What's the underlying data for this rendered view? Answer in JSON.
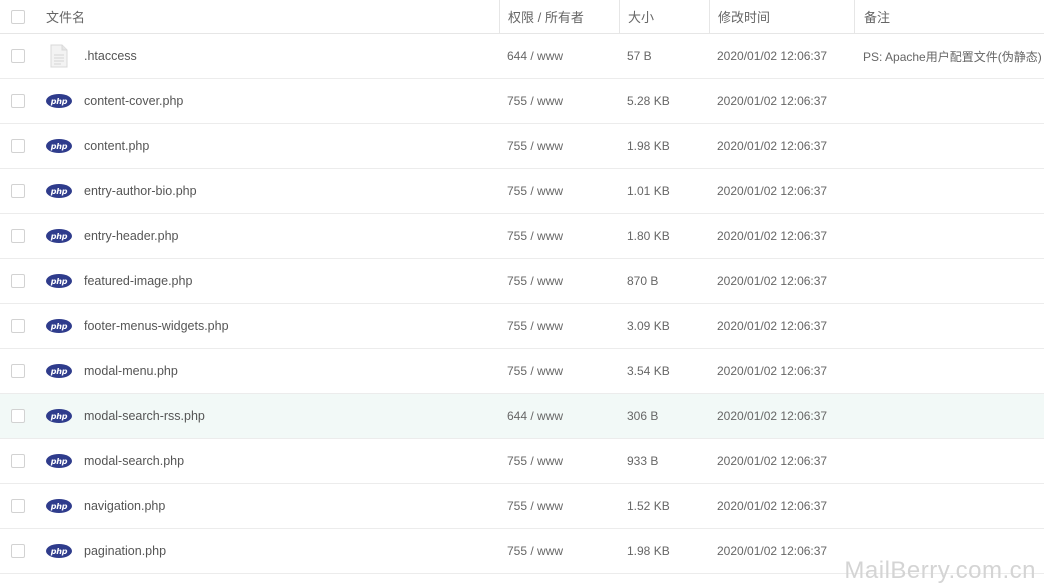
{
  "header": {
    "name": "文件名",
    "permission": "权限 / 所有者",
    "size": "大小",
    "modified": "修改时间",
    "note": "备注"
  },
  "rows": [
    {
      "icon": "file-icon",
      "name": ".htaccess",
      "perm": "644 / www",
      "size": "57 B",
      "time": "2020/01/02 12:06:37",
      "note": "PS: Apache用户配置文件(伪静态)"
    },
    {
      "icon": "php-icon",
      "name": "content-cover.php",
      "perm": "755 / www",
      "size": "5.28 KB",
      "time": "2020/01/02 12:06:37",
      "note": ""
    },
    {
      "icon": "php-icon",
      "name": "content.php",
      "perm": "755 / www",
      "size": "1.98 KB",
      "time": "2020/01/02 12:06:37",
      "note": ""
    },
    {
      "icon": "php-icon",
      "name": "entry-author-bio.php",
      "perm": "755 / www",
      "size": "1.01 KB",
      "time": "2020/01/02 12:06:37",
      "note": ""
    },
    {
      "icon": "php-icon",
      "name": "entry-header.php",
      "perm": "755 / www",
      "size": "1.80 KB",
      "time": "2020/01/02 12:06:37",
      "note": ""
    },
    {
      "icon": "php-icon",
      "name": "featured-image.php",
      "perm": "755 / www",
      "size": "870 B",
      "time": "2020/01/02 12:06:37",
      "note": ""
    },
    {
      "icon": "php-icon",
      "name": "footer-menus-widgets.php",
      "perm": "755 / www",
      "size": "3.09 KB",
      "time": "2020/01/02 12:06:37",
      "note": ""
    },
    {
      "icon": "php-icon",
      "name": "modal-menu.php",
      "perm": "755 / www",
      "size": "3.54 KB",
      "time": "2020/01/02 12:06:37",
      "note": ""
    },
    {
      "icon": "php-icon",
      "name": "modal-search-rss.php",
      "perm": "644 / www",
      "size": "306 B",
      "time": "2020/01/02 12:06:37",
      "note": ""
    },
    {
      "icon": "php-icon",
      "name": "modal-search.php",
      "perm": "755 / www",
      "size": "933 B",
      "time": "2020/01/02 12:06:37",
      "note": ""
    },
    {
      "icon": "php-icon",
      "name": "navigation.php",
      "perm": "755 / www",
      "size": "1.52 KB",
      "time": "2020/01/02 12:06:37",
      "note": ""
    },
    {
      "icon": "php-icon",
      "name": "pagination.php",
      "perm": "755 / www",
      "size": "1.98 KB",
      "time": "2020/01/02 12:06:37",
      "note": ""
    }
  ],
  "php_icon_text": "php",
  "watermark": "MailBerry.com.cn",
  "colors": {
    "php_icon": "#2f3c8c",
    "hover_row": "#f2f9f7",
    "border": "#ececec"
  }
}
